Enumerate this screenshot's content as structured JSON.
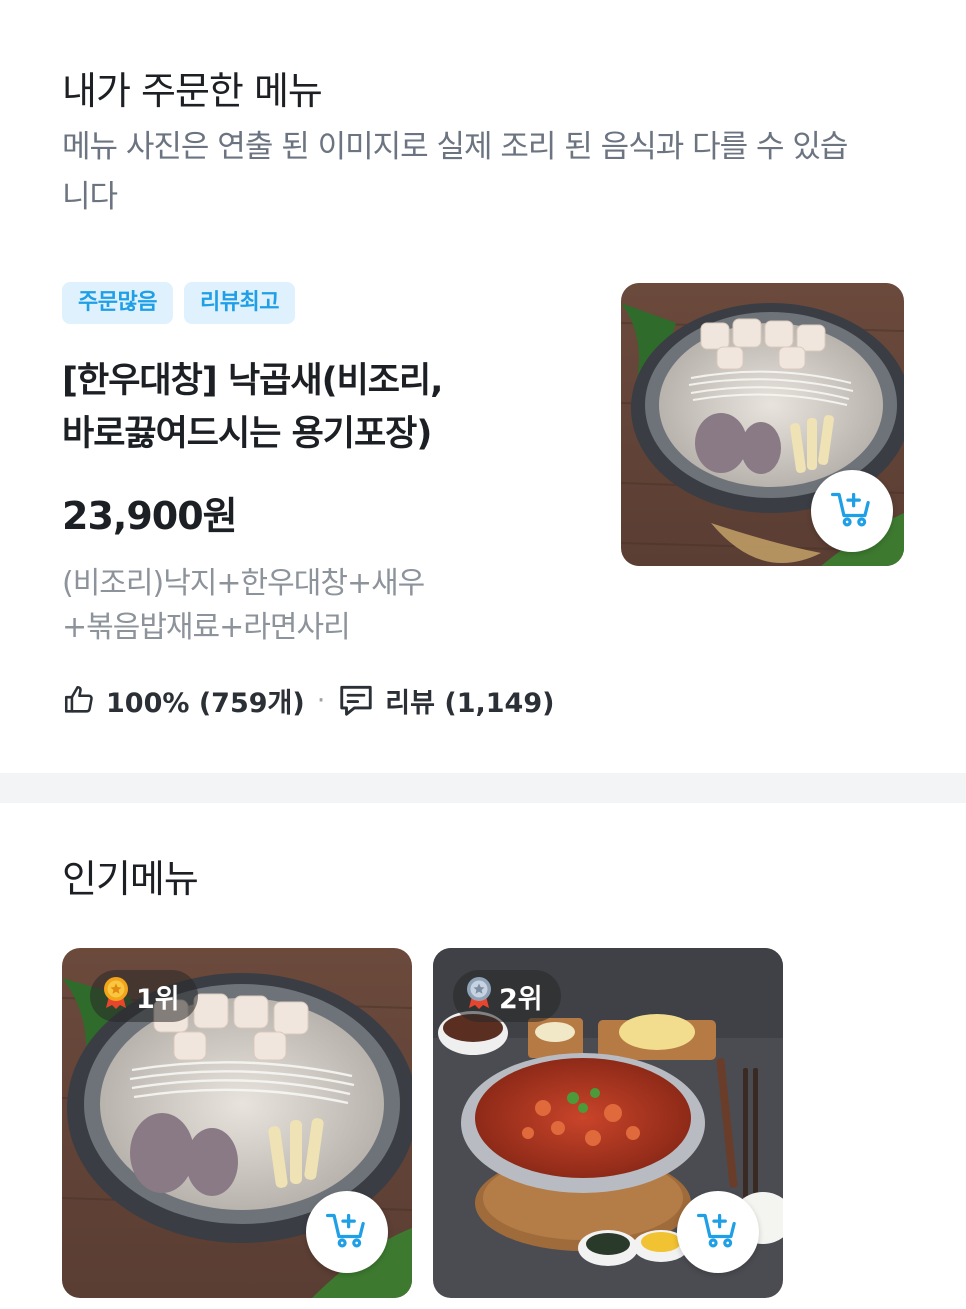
{
  "ordered": {
    "title": "내가 주문한 메뉴",
    "notice": "메뉴 사진은 연출 된 이미지로 실제 조리 된 음식과 다를 수 있습니다",
    "badges": [
      "주문많음",
      "리뷰최고"
    ],
    "name_line1": "[한우대창] 낙곱새(비조리,",
    "name_line2": "바로끓여드시는 용기포장)",
    "price": "23,900원",
    "desc_line1": "(비조리)낙지+한우대창+새우",
    "desc_line2": "+볶음밥재료+라면사리",
    "like_text": "100% (759개)",
    "separator": "·",
    "review_text": "리뷰 (1,149)"
  },
  "popular": {
    "title": "인기메뉴",
    "items": [
      {
        "rank": "1위"
      },
      {
        "rank": "2위"
      }
    ]
  },
  "colors": {
    "accent": "#1e9fe6",
    "badge_bg": "#dff1fd",
    "text": "#1c1f24",
    "muted": "#8d939b"
  },
  "icons": [
    "thumbs-up-icon",
    "review-icon",
    "add-to-cart-icon",
    "gold-medal-icon",
    "silver-medal-icon"
  ]
}
